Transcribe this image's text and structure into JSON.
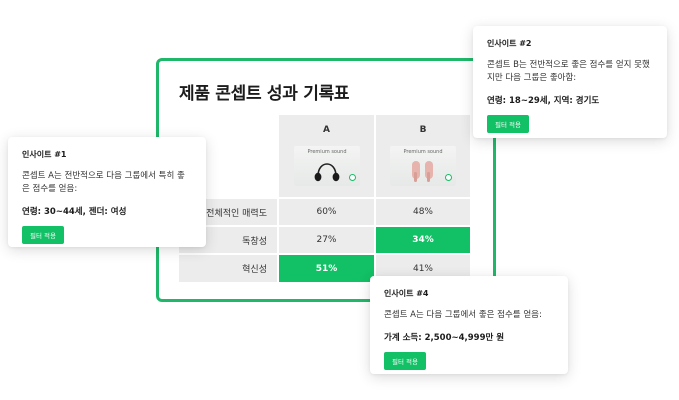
{
  "scorecard": {
    "title": "제품 콘셉트 성과 기록표",
    "columns": [
      "A",
      "B"
    ],
    "product_caption": "Premium sound",
    "rows": [
      {
        "label": "전체적인 매력도",
        "a": "60%",
        "b": "48%"
      },
      {
        "label": "독창성",
        "a": "27%",
        "b": "34%"
      },
      {
        "label": "혁신성",
        "a": "51%",
        "b": "41%"
      }
    ],
    "colors": {
      "accent": "#12c065",
      "border": "#1fb86a",
      "cell": "#ececec"
    }
  },
  "insights": [
    {
      "title": "인사이트 #1",
      "body": "콘셉트 A는 전반적으로 다음 그룹에서 특히 좋은 점수를 얻음:",
      "highlight": "연령: 30~44세, 젠더: 여성",
      "button": "필터 적용"
    },
    {
      "title": "인사이트 #2",
      "body": "콘셉트 B는 전반적으로 좋은 점수를 얻지 못했지만 다음 그룹은 좋아함:",
      "highlight": "연령: 18~29세, 지역: 경기도",
      "button": "필터 적용"
    },
    {
      "title": "인사이트 #4",
      "body": "콘셉트 A는 다음 그룹에서 좋은 점수를 얻음:",
      "highlight": "가계 소득: 2,500~4,999만 원",
      "button": "필터 적용"
    }
  ]
}
